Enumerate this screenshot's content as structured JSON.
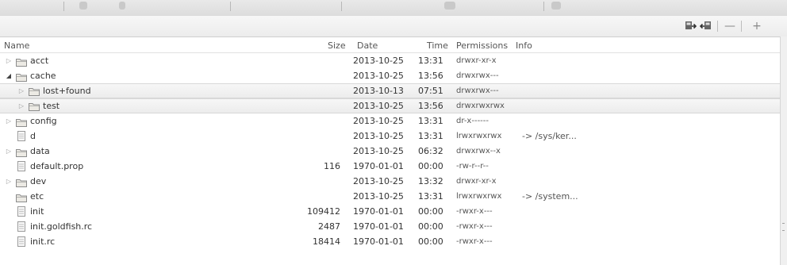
{
  "toolbar": {
    "icons": [
      "pull-icon",
      "push-icon",
      "delete-icon",
      "new-folder-icon"
    ],
    "minus_glyph": "—",
    "plus_glyph": "+"
  },
  "header": {
    "name": "Name",
    "size": "Size",
    "date": "Date",
    "time": "Time",
    "permissions": "Permissions",
    "info": "Info"
  },
  "rows": [
    {
      "name": "acct",
      "type": "folder",
      "expand": "collapsed",
      "level": 0,
      "size": "",
      "date": "2013-10-25",
      "time": "13:31",
      "perm": "drwxr-xr-x",
      "info": ""
    },
    {
      "name": "cache",
      "type": "folder",
      "expand": "expanded",
      "level": 0,
      "size": "",
      "date": "2013-10-25",
      "time": "13:56",
      "perm": "drwxrwx---",
      "info": ""
    },
    {
      "name": "lost+found",
      "type": "folder",
      "expand": "collapsed",
      "level": 1,
      "size": "",
      "date": "2013-10-13",
      "time": "07:51",
      "perm": "drwxrwx---",
      "info": ""
    },
    {
      "name": "test",
      "type": "folder",
      "expand": "collapsed",
      "level": 1,
      "size": "",
      "date": "2013-10-25",
      "time": "13:56",
      "perm": "drwxrwxrwx",
      "info": ""
    },
    {
      "name": "config",
      "type": "folder",
      "expand": "collapsed",
      "level": 0,
      "size": "",
      "date": "2013-10-25",
      "time": "13:31",
      "perm": "dr-x------",
      "info": ""
    },
    {
      "name": "d",
      "type": "link",
      "expand": "none",
      "level": 0,
      "size": "",
      "date": "2013-10-25",
      "time": "13:31",
      "perm": "lrwxrwxrwx",
      "info": "-> /sys/ker..."
    },
    {
      "name": "data",
      "type": "folder",
      "expand": "collapsed",
      "level": 0,
      "size": "",
      "date": "2013-10-25",
      "time": "06:32",
      "perm": "drwxrwx--x",
      "info": ""
    },
    {
      "name": "default.prop",
      "type": "file",
      "expand": "none",
      "level": 0,
      "size": "116",
      "date": "1970-01-01",
      "time": "00:00",
      "perm": "-rw-r--r--",
      "info": ""
    },
    {
      "name": "dev",
      "type": "folder",
      "expand": "collapsed",
      "level": 0,
      "size": "",
      "date": "2013-10-25",
      "time": "13:32",
      "perm": "drwxr-xr-x",
      "info": ""
    },
    {
      "name": "etc",
      "type": "folder",
      "expand": "none",
      "level": 0,
      "size": "",
      "date": "2013-10-25",
      "time": "13:31",
      "perm": "lrwxrwxrwx",
      "info": "-> /system..."
    },
    {
      "name": "init",
      "type": "file",
      "expand": "none",
      "level": 0,
      "size": "109412",
      "date": "1970-01-01",
      "time": "00:00",
      "perm": "-rwxr-x---",
      "info": ""
    },
    {
      "name": "init.goldfish.rc",
      "type": "file",
      "expand": "none",
      "level": 0,
      "size": "2487",
      "date": "1970-01-01",
      "time": "00:00",
      "perm": "-rwxr-x---",
      "info": ""
    },
    {
      "name": "init.rc",
      "type": "file",
      "expand": "none",
      "level": 0,
      "size": "18414",
      "date": "1970-01-01",
      "time": "00:00",
      "perm": "-rwxr-x---",
      "info": ""
    }
  ],
  "colors": {
    "folder_fill": "#eceae4",
    "folder_stroke": "#8c8c8c",
    "selection_bg": "#efefef"
  }
}
